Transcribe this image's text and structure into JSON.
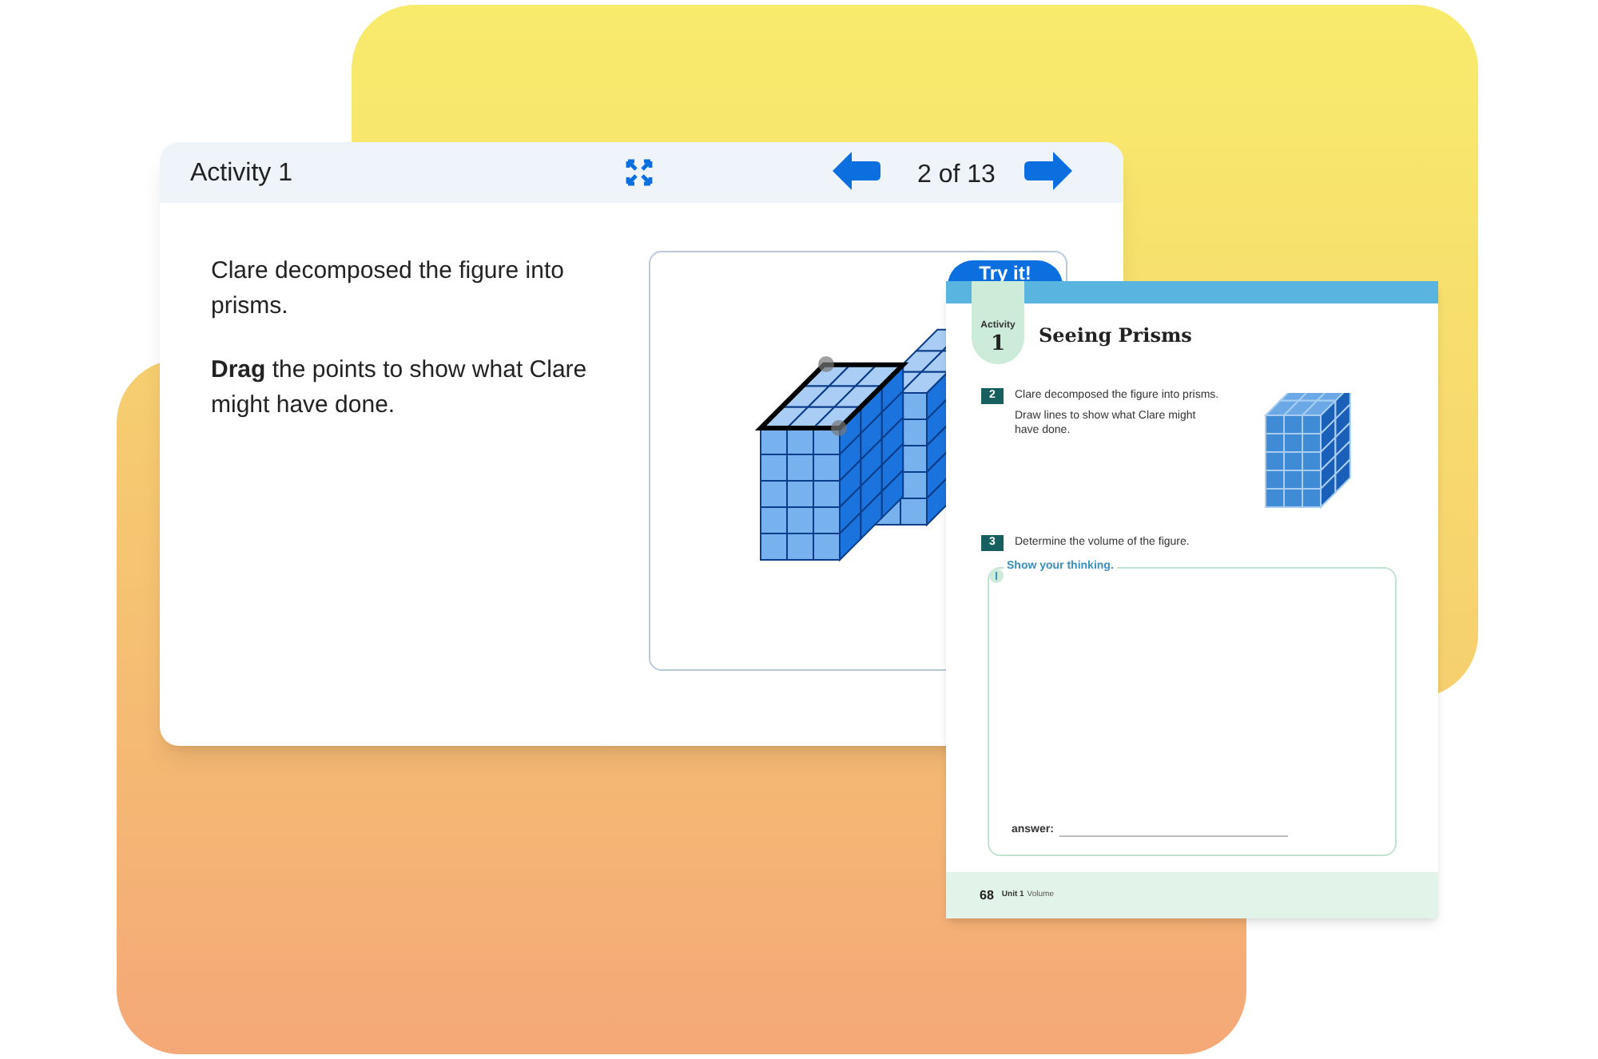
{
  "activity_card": {
    "title": "Activity 1",
    "page_indicator": "2 of 13",
    "prompt": [
      "Clare decomposed the figure into prisms.",
      "**Drag** the points to show what Clare might have done."
    ],
    "try_button": "Try it!"
  },
  "worksheet": {
    "activity_label": "Activity",
    "activity_number": "1",
    "title": "Seeing Prisms",
    "problems": [
      {
        "number": "2",
        "lines": [
          "Clare decomposed the figure into prisms.",
          "Draw lines to show what Clare might have done."
        ],
        "kind": "with_figure"
      },
      {
        "number": "3",
        "lines": [
          "Determine the volume of the figure."
        ],
        "kind": "text_only"
      }
    ],
    "thinking_label": "Show your thinking.",
    "answer_label": "answer:",
    "footer": {
      "page": "68",
      "unit": "Unit 1",
      "topic": "Volume"
    }
  }
}
